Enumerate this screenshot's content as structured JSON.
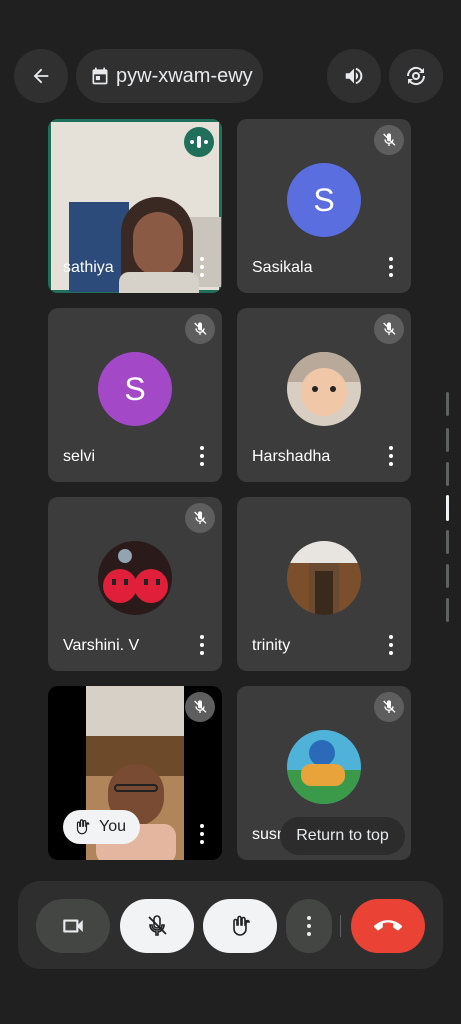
{
  "header": {
    "meeting_code": "pyw-xwam-ewy"
  },
  "participants": [
    {
      "name": "sathiya",
      "type": "video",
      "speaking": true
    },
    {
      "name": "Sasikala",
      "type": "letter",
      "letter": "S",
      "color": "#5b6ee0",
      "muted": true
    },
    {
      "name": "selvi",
      "type": "letter",
      "letter": "S",
      "color": "#a349c8",
      "muted": true
    },
    {
      "name": "Harshadha",
      "type": "photo",
      "muted": true
    },
    {
      "name": "Varshini. V",
      "type": "photo",
      "muted": true
    },
    {
      "name": "trinity",
      "type": "photo",
      "muted": true
    },
    {
      "name": "You",
      "type": "video",
      "muted": true,
      "hand_raised": true
    },
    {
      "name": "susm",
      "type": "photo",
      "muted": true
    }
  ],
  "return_to_top_label": "Return to top",
  "colors": {
    "background": "#1f201f",
    "tile": "#3b3c3b",
    "speaking_border": "#1f6f5a",
    "end_call": "#ea4335"
  }
}
